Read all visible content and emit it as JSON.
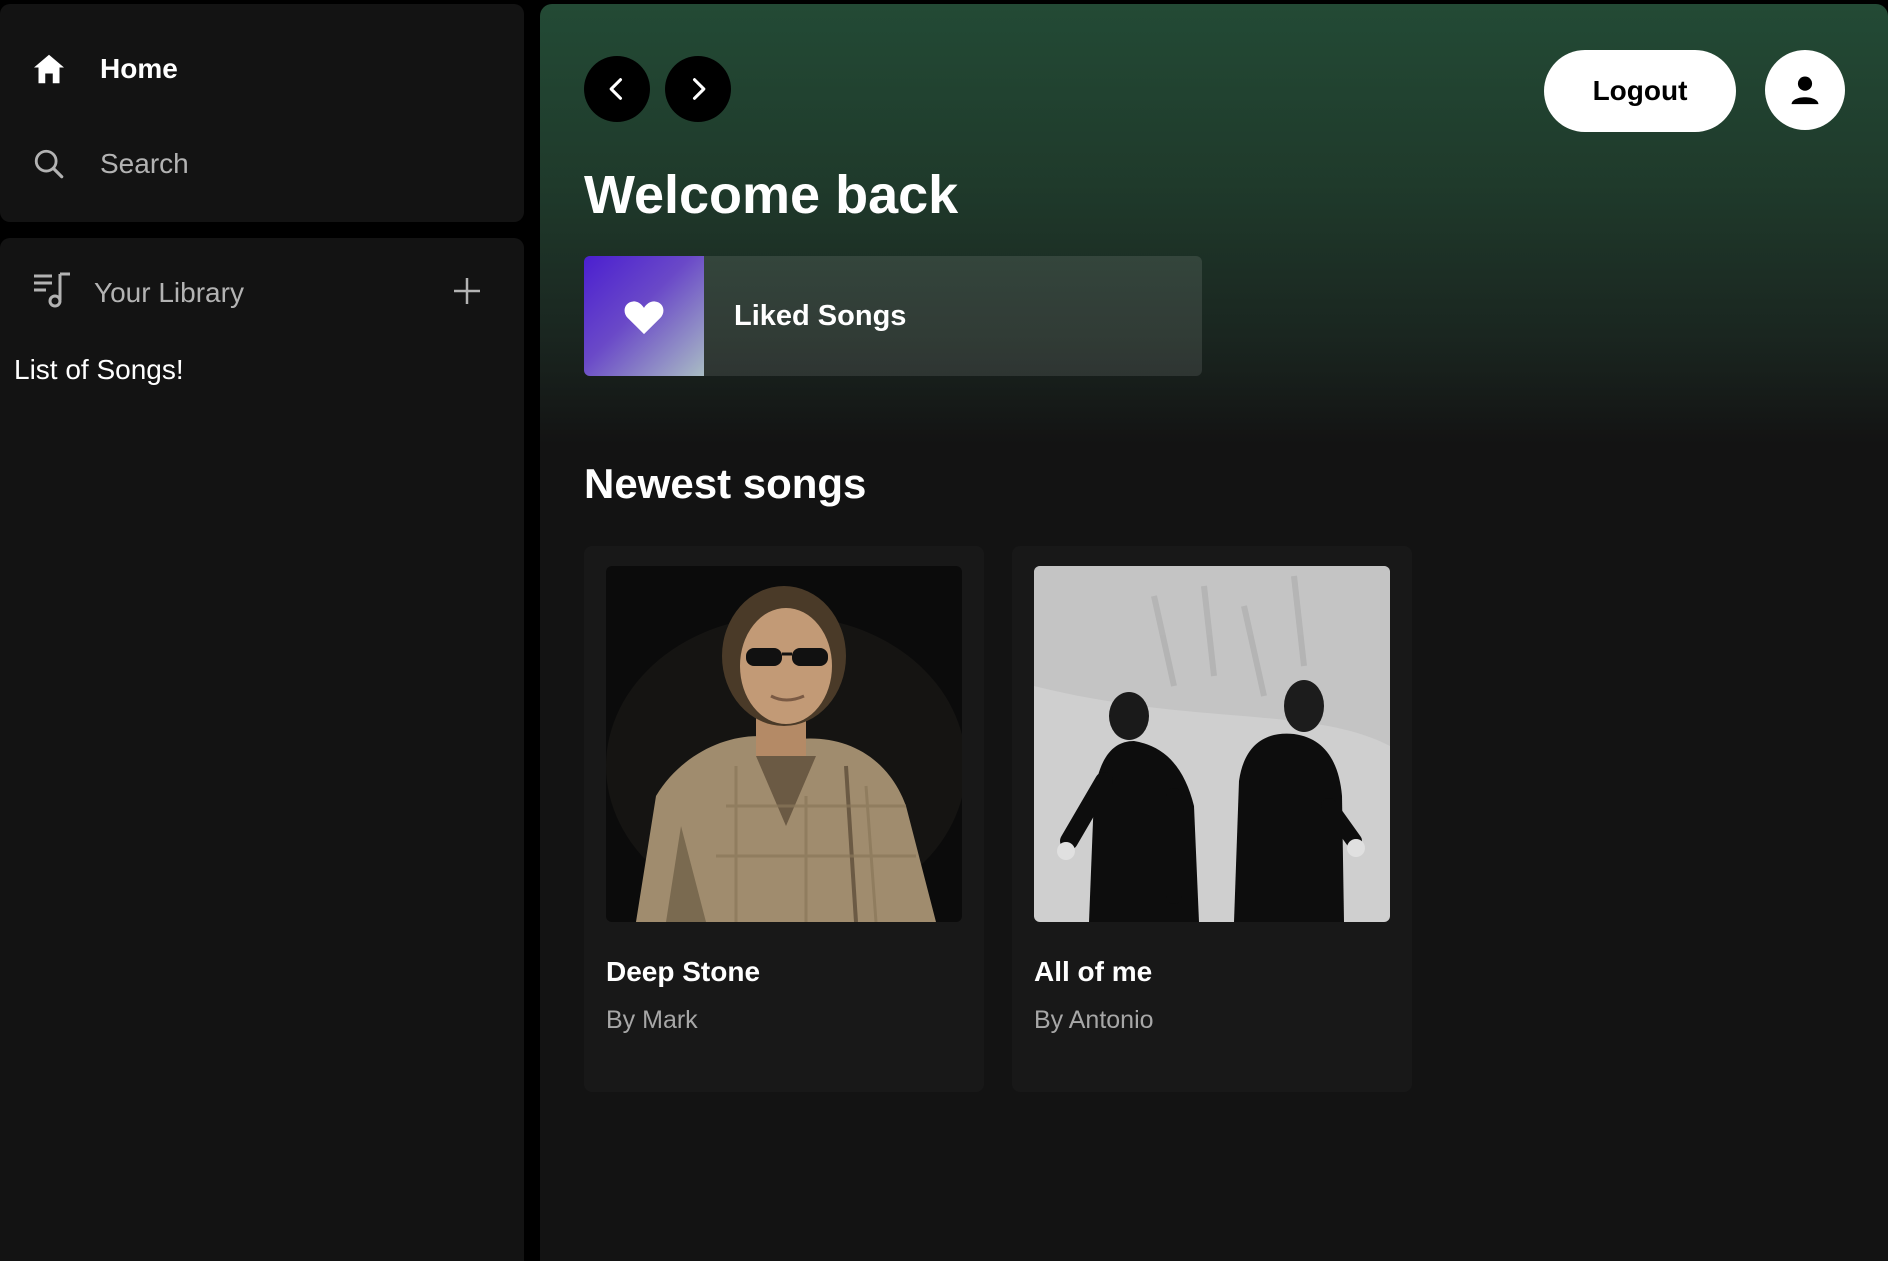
{
  "sidebar": {
    "home_label": "Home",
    "search_label": "Search",
    "library_label": "Your Library",
    "library_list_title": "List of Songs!"
  },
  "header": {
    "logout_label": "Logout"
  },
  "main": {
    "welcome_title": "Welcome back",
    "liked_songs_label": "Liked Songs",
    "section_title": "Newest songs",
    "songs": [
      {
        "title": "Deep Stone",
        "artist": "By Mark"
      },
      {
        "title": "All of me",
        "artist": "By Antonio"
      }
    ]
  },
  "colors": {
    "background": "#000000",
    "panel": "#131313",
    "card": "#181818",
    "header_gradient_top": "#234a35",
    "muted_text": "#b3b3b3"
  }
}
